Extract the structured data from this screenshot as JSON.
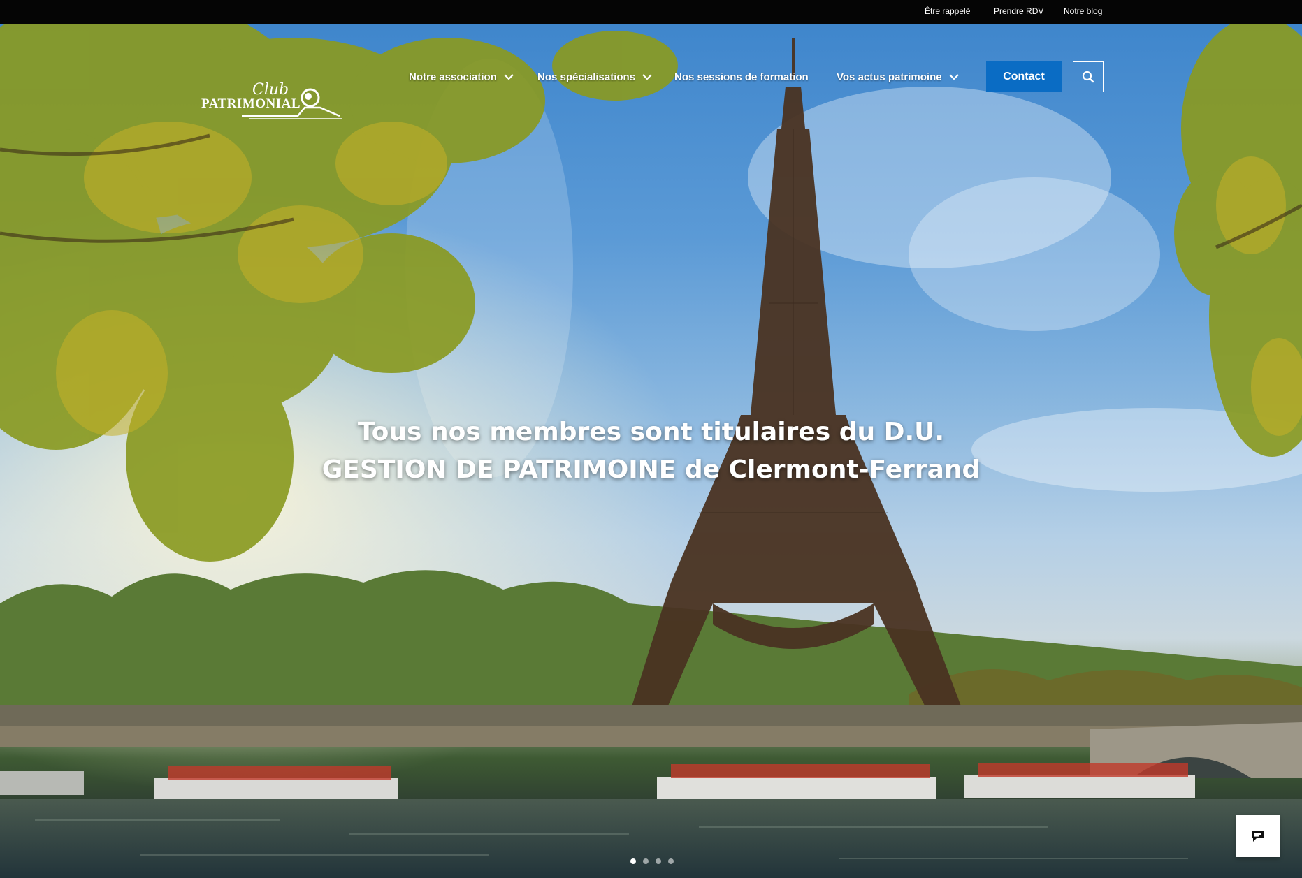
{
  "topbar": {
    "links": [
      "Être rappelé",
      "Prendre RDV",
      "Notre blog"
    ]
  },
  "logo": {
    "line1": "Club",
    "line2": "PATRIMONIAL"
  },
  "nav": {
    "items": [
      {
        "label": "Notre association",
        "dropdown": true
      },
      {
        "label": "Nos spécialisations",
        "dropdown": true
      },
      {
        "label": "Nos sessions de formation",
        "dropdown": false
      },
      {
        "label": "Vos actus patrimoine",
        "dropdown": true
      }
    ],
    "contact_label": "Contact",
    "search_icon": "search-icon"
  },
  "hero": {
    "headline_line1": "Tous nos membres sont titulaires du D.U.",
    "headline_line2": "GESTION DE PATRIMOINE de Clermont-Ferrand",
    "slides_total": 4,
    "active_slide": 1
  },
  "chat": {
    "icon": "chat-icon"
  },
  "colors": {
    "contact_button": "#0a6cc4",
    "topbar_bg": "#050505"
  }
}
